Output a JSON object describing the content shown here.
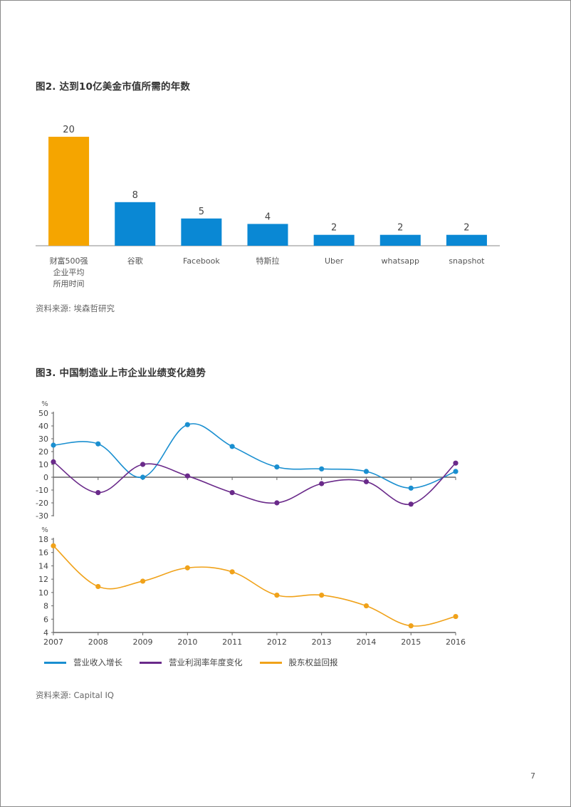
{
  "page_number": "7",
  "figure2": {
    "title": "图2. 达到10亿美金市值所需的年数",
    "source": "资料来源: 埃森哲研究"
  },
  "figure3": {
    "title": "图3. 中国制造业上市企业业绩变化趋势",
    "source": "资料来源: Capital IQ",
    "top_unit": "%",
    "bottom_unit": "%"
  },
  "chart_data": [
    {
      "type": "bar",
      "title": "图2. 达到10亿美金市值所需的年数",
      "categories": [
        [
          "财富500强",
          "企业平均",
          "所用时间"
        ],
        [
          "谷歌"
        ],
        [
          "Facebook"
        ],
        [
          "特斯拉"
        ],
        [
          "Uber"
        ],
        [
          "whatsapp"
        ],
        [
          "snapshot"
        ]
      ],
      "values": [
        20,
        8,
        5,
        4,
        2,
        2,
        2
      ],
      "colors": [
        "#f5a500",
        "#0a88d4",
        "#0a88d4",
        "#0a88d4",
        "#0a88d4",
        "#0a88d4",
        "#0a88d4"
      ],
      "data_labels": [
        "20",
        "8",
        "5",
        "4",
        "2",
        "2",
        "2"
      ],
      "xlabel": "",
      "ylabel": "",
      "ylim": [
        0,
        20
      ],
      "grid": false
    },
    {
      "type": "line",
      "title": "图3. 中国制造业上市企业业绩变化趋势 (上)",
      "x": [
        "2007",
        "2008",
        "2009",
        "2010",
        "2011",
        "2012",
        "2013",
        "2014",
        "2015",
        "2016"
      ],
      "ylabel": "%",
      "ylim": [
        -30,
        50
      ],
      "yticks": [
        "50",
        "40",
        "30",
        "20",
        "10",
        "0",
        "-10",
        "-20",
        "-30"
      ],
      "series": [
        {
          "name": "营业收入增长",
          "color": "#1a8fd0",
          "values": [
            25,
            26,
            0,
            41,
            24,
            8,
            6.5,
            4.5,
            -8.5,
            4.5
          ]
        },
        {
          "name": "营业利润率年度变化",
          "color": "#6a2a8a",
          "values": [
            12,
            -12,
            10,
            1,
            -12,
            -20,
            -5,
            -3.5,
            -21,
            11
          ]
        }
      ],
      "grid": false
    },
    {
      "type": "line",
      "title": "图3. 中国制造业上市企业业绩变化趋势 (下)",
      "x": [
        "2007",
        "2008",
        "2009",
        "2010",
        "2011",
        "2012",
        "2013",
        "2014",
        "2015",
        "2016"
      ],
      "ylabel": "%",
      "ylim": [
        4,
        18
      ],
      "yticks": [
        "18",
        "16",
        "14",
        "12",
        "10",
        "8",
        "6",
        "4"
      ],
      "series": [
        {
          "name": "股东权益回报",
          "color": "#f0a21a",
          "values": [
            17,
            10.9,
            11.7,
            13.7,
            13.1,
            9.6,
            9.6,
            8,
            5,
            6.4
          ]
        }
      ],
      "grid": false
    }
  ],
  "legend": [
    {
      "label": "营业收入增长",
      "color": "#1a8fd0"
    },
    {
      "label": "营业利润率年度变化",
      "color": "#6a2a8a"
    },
    {
      "label": "股东权益回报",
      "color": "#f0a21a"
    }
  ]
}
